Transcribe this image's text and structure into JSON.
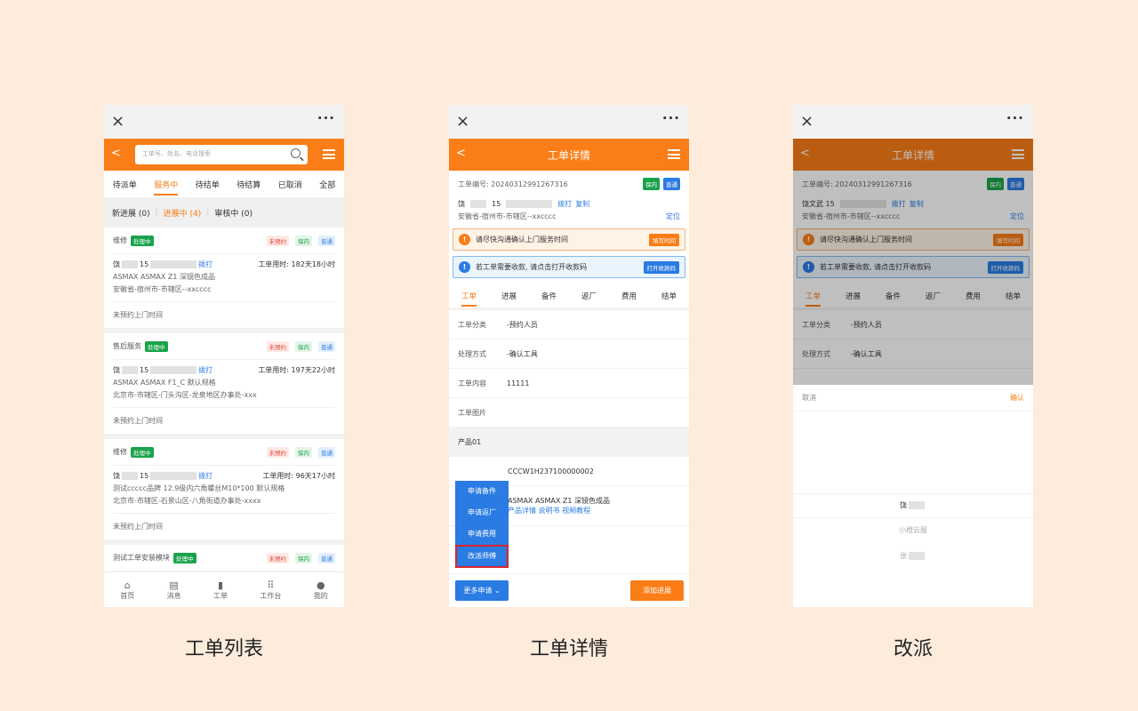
{
  "common": {
    "close": "×",
    "more": "···"
  },
  "list": {
    "search_placeholder": "工单号、姓名、电话搜索",
    "tabs": [
      "待派单",
      "服务中",
      "待结单",
      "待结算",
      "已取消",
      "全部"
    ],
    "subtabs": [
      "新进展 (0)",
      "进展中 (4)",
      "审核中 (0)"
    ],
    "cards": [
      {
        "type": "维修",
        "status": "处理中",
        "tags": [
          "未预约",
          "保内",
          "普通"
        ],
        "name": "饶",
        "phone": "15",
        "call": "拨打",
        "duration": "工单用时: 182天18小时",
        "product": "ASMAX ASMAX Z1 深镜色成品",
        "address": "安徽省-宿州市-市辖区--xxcccc",
        "appt": "未预约上门时间"
      },
      {
        "type": "售后服务",
        "status": "处理中",
        "tags": [
          "未预约",
          "保内",
          "普通"
        ],
        "name": "饶",
        "phone": "15",
        "call": "拨打",
        "duration": "工单用时: 197天22小时",
        "product": "ASMAX ASMAX F1_C 默认规格",
        "address": "北京市-市辖区-门头沟区-龙泉地区办事处-xxx",
        "appt": "未预约上门时间"
      },
      {
        "type": "维修",
        "status": "处理中",
        "tags": [
          "未预约",
          "保内",
          "普通"
        ],
        "name": "饶",
        "phone": "15",
        "call": "拨打",
        "duration": "工单用时: 96天17小时",
        "product": "测试ccccc品牌 12.9级内六角螺丝M10*100 默认规格",
        "address": "北京市-市辖区-石景山区-八角街道办事处-xxxx",
        "appt": "未预约上门时间"
      },
      {
        "type": "测试工单安装模块",
        "status": "处理中",
        "tags": [
          "未预约",
          "保内",
          "普通"
        ]
      }
    ],
    "nav": [
      {
        "icon": "⌂",
        "label": "首页"
      },
      {
        "icon": "▤",
        "label": "消息"
      },
      {
        "icon": "▮",
        "label": "工单"
      },
      {
        "icon": "⠿",
        "label": "工作台"
      },
      {
        "icon": "●",
        "label": "我的"
      }
    ]
  },
  "detail": {
    "back": "<",
    "title": "工单详情",
    "order_no": "工单编号: 20240312991267316",
    "tag1": "保内",
    "tag2": "普通",
    "name": "饶",
    "phone": "15",
    "call": "拨打",
    "copy": "复制",
    "address": "安徽省-宿州市-市辖区--xxcccc",
    "locate": "定位",
    "notice1": "请尽快沟通确认上门服务时间",
    "notice1_btn": "填写时间",
    "notice2": "若工单需要收款, 请点击打开收款码",
    "notice2_btn": "打开收款码",
    "tabs": [
      "工单",
      "进展",
      "备件",
      "返厂",
      "费用",
      "结单"
    ],
    "fields": [
      {
        "label": "工单分类",
        "value": "-预约人员"
      },
      {
        "label": "处理方式",
        "value": "-确认工具"
      },
      {
        "label": "工单内容",
        "value": "11111"
      },
      {
        "label": "工单图片",
        "value": ""
      }
    ],
    "product_header": "产品01",
    "serial": "CCCW1H237100000002",
    "product_name": "ASMAX ASMAX Z1 深镜色成品",
    "product_links": "产品详情  说明书  视频教程",
    "menu": [
      "申请备件",
      "申请返厂",
      "申请费用",
      "改派师傅"
    ],
    "more_btn": "更多申请 ⌄",
    "add_btn": "添加进展"
  },
  "reassign": {
    "name_line": "饶文武 15",
    "cancel": "取消",
    "confirm": "确认",
    "options": [
      "饶",
      "小橙云服",
      "张"
    ]
  },
  "captions": [
    "工单列表",
    "工单详情",
    "改派"
  ]
}
